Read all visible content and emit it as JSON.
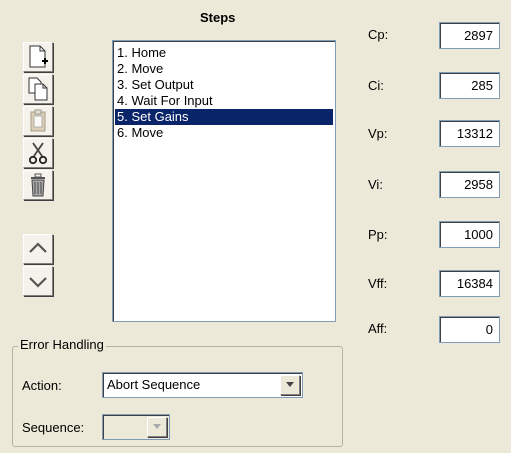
{
  "steps": {
    "title": "Steps",
    "items": [
      "1. Home",
      "2. Move",
      "3. Set Output",
      "4. Wait For Input",
      "5. Set Gains",
      "6. Move"
    ],
    "selected_index": 4
  },
  "toolbar": {
    "icons": [
      "new-step-icon",
      "copy-icon",
      "paste-icon",
      "cut-icon",
      "delete-icon",
      "move-up-icon",
      "move-down-icon"
    ]
  },
  "error_handling": {
    "legend": "Error Handling",
    "action_label": "Action:",
    "action_value": "Abort Sequence",
    "sequence_label": "Sequence:",
    "sequence_value": ""
  },
  "gains": {
    "cp": {
      "label": "Cp:",
      "value": "2897"
    },
    "ci": {
      "label": "Ci:",
      "value": "285"
    },
    "vp": {
      "label": "Vp:",
      "value": "13312"
    },
    "vi": {
      "label": "Vi:",
      "value": "2958"
    },
    "pp": {
      "label": "Pp:",
      "value": "1000"
    },
    "vff": {
      "label": "Vff:",
      "value": "16384"
    },
    "aff": {
      "label": "Aff:",
      "value": "0"
    }
  },
  "colors": {
    "background": "#ece9d8",
    "selection": "#0a246a",
    "field_border": "#7f9db9"
  }
}
